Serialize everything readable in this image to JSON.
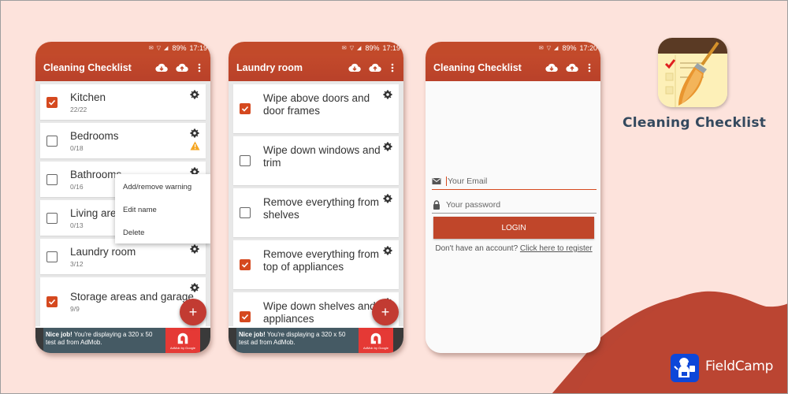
{
  "colors": {
    "background": "#fde3dc",
    "accent": "#c24a2a",
    "checkbox_checked": "#d5491f",
    "fab": "#c23b32",
    "ad_body": "#455a64",
    "ad_logo": "#e53935",
    "brand_title": "#34495e",
    "fieldcamp_blue": "#0d47d9"
  },
  "status_bar": {
    "battery": "89%",
    "time_screen1": "17:19",
    "time_screen2": "17:19",
    "time_screen3": "17:20"
  },
  "screen1": {
    "title": "Cleaning Checklist",
    "actions": [
      "cloud-download-icon",
      "cloud-upload-icon",
      "more-vert-icon"
    ],
    "rooms": [
      {
        "name": "Kitchen",
        "count": "22/22",
        "checked": true,
        "warning": false
      },
      {
        "name": "Bedrooms",
        "count": "0/18",
        "checked": false,
        "warning": true
      },
      {
        "name": "Bathrooms",
        "count": "0/16",
        "checked": false,
        "warning": false
      },
      {
        "name": "Living area",
        "count": "0/13",
        "checked": false,
        "warning": false
      },
      {
        "name": "Laundry room",
        "count": "3/12",
        "checked": false,
        "warning": false
      },
      {
        "name": "Storage areas and garage",
        "count": "9/9",
        "checked": true,
        "warning": false
      }
    ],
    "context_menu": [
      "Add/remove warning",
      "Edit name",
      "Delete"
    ],
    "fab_label": "+"
  },
  "screen2": {
    "title": "Laundry room",
    "tasks": [
      {
        "name": "Wipe above doors and door frames",
        "checked": true
      },
      {
        "name": "Wipe down windows and trim",
        "checked": false
      },
      {
        "name": "Remove everything from shelves",
        "checked": false
      },
      {
        "name": "Remove everything from top of appliances",
        "checked": true
      },
      {
        "name": "Wipe down shelves and appliances",
        "checked": true
      }
    ],
    "fab_label": "+"
  },
  "ad": {
    "bold": "Nice job!",
    "text": " You're displaying a 320 x 50 test ad from AdMob.",
    "logo_caption": "AdMob by Google"
  },
  "screen3": {
    "title": "Cleaning Checklist",
    "email_placeholder": "Your Email",
    "password_placeholder": "Your password",
    "login_label": "LOGIN",
    "register_prompt": "Don't have an account? ",
    "register_link": "Click here to register"
  },
  "brand": {
    "app_name": "Cleaning Checklist",
    "company": "FieldCamp"
  }
}
